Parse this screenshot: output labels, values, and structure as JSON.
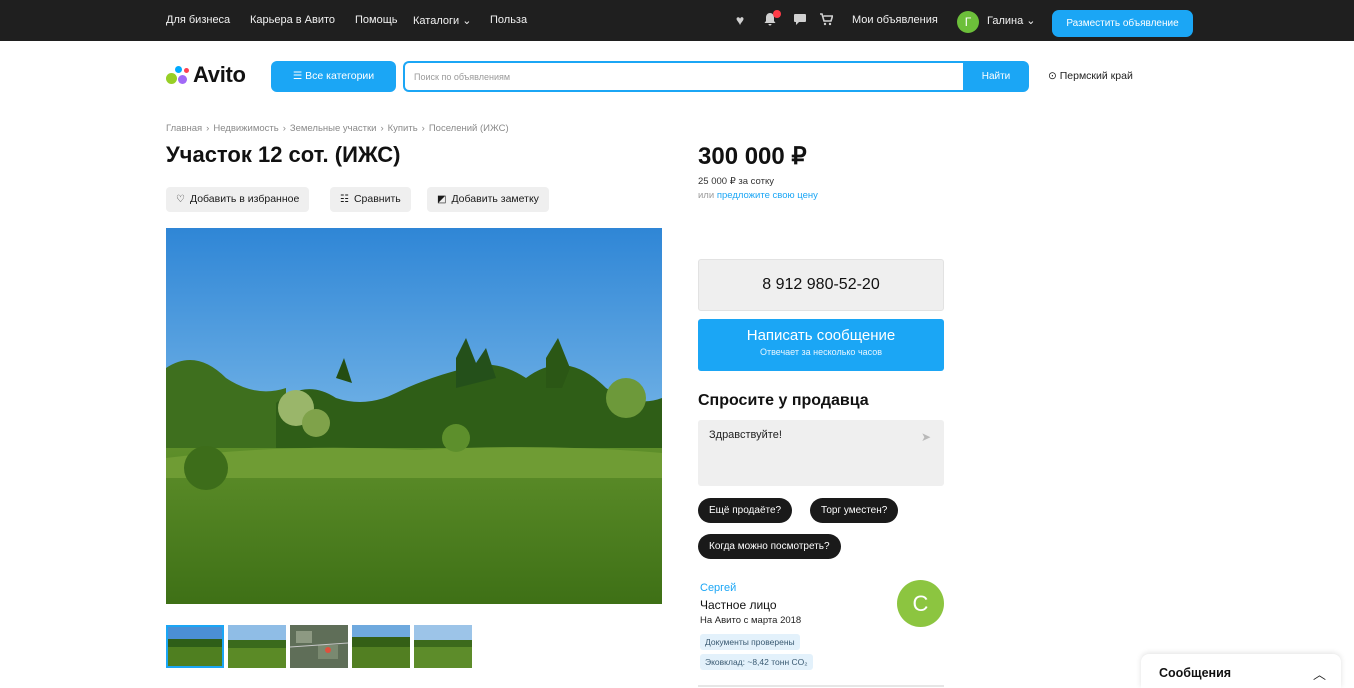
{
  "topbar": {
    "links": [
      "Для бизнеса",
      "Карьера в Авито",
      "Помощь",
      "Каталоги",
      "Польза"
    ],
    "catalog_chevron": "⌄",
    "my_ads": "Мои объявления",
    "user_initial": "Г",
    "user_name": "Галина",
    "post_ad": "Разместить объявление",
    "icons": [
      "heart-icon",
      "bell-icon",
      "chat-icon",
      "cart-icon"
    ]
  },
  "header": {
    "logo_text": "Avito",
    "categories_button": "Все категории",
    "search_placeholder": "Поиск по объявлениям",
    "find_button": "Найти",
    "region": "Пермский край"
  },
  "breadcrumbs": [
    "Главная",
    "Недвижимость",
    "Земельные участки",
    "Купить",
    "Поселений (ИЖС)"
  ],
  "listing": {
    "title": "Участок 12 сот. (ИЖС)",
    "actions": {
      "favorite": "Добавить в избранное",
      "compare": "Сравнить",
      "note": "Добавить заметку"
    },
    "photo_count": 5,
    "selected_photo": 1
  },
  "pricing": {
    "price": "300 000 ₽",
    "per_unit": "25 000 ₽ за сотку",
    "offer_prefix": "или",
    "offer_link": "предложите свою цену"
  },
  "contact": {
    "phone": "8 912 980-52-20",
    "message_button": "Написать сообщение",
    "message_sub": "Отвечает за несколько часов"
  },
  "ask": {
    "heading": "Спросите у продавца",
    "message_value": "Здравствуйте!",
    "quick_replies": [
      "Ещё продаёте?",
      "Торг уместен?",
      "Когда можно посмотреть?"
    ]
  },
  "seller": {
    "name": "Сергей",
    "type": "Частное лицо",
    "since": "На Авито с марта 2018",
    "avatar_initial": "С",
    "tags": [
      "Документы проверены",
      "Эковклад: ~8,42 тонн CO₂"
    ]
  },
  "messages_widget": {
    "label": "Сообщения"
  },
  "colors": {
    "accent": "#1ba6f5",
    "topbar_bg": "#1f1f1f",
    "chip_bg": "#1a1a1a",
    "avatar_green": "#8cc540"
  }
}
